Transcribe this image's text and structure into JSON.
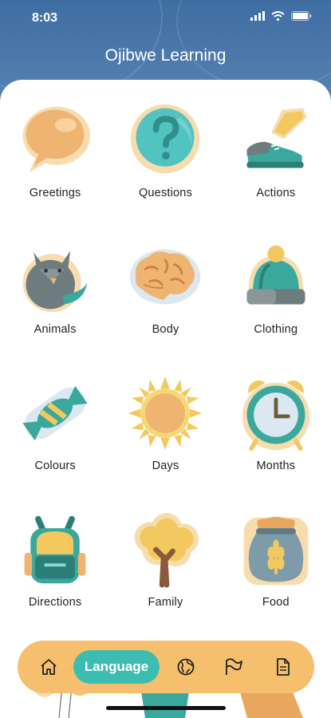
{
  "status_bar": {
    "time": "8:03"
  },
  "app": {
    "title": "Ojibwe Learning"
  },
  "categories": [
    {
      "label": "Greetings",
      "icon": "speech-bubble-icon"
    },
    {
      "label": "Questions",
      "icon": "question-mark-icon"
    },
    {
      "label": "Actions",
      "icon": "running-shoe-icon"
    },
    {
      "label": "Animals",
      "icon": "fox-icon"
    },
    {
      "label": "Body",
      "icon": "brain-icon"
    },
    {
      "label": "Clothing",
      "icon": "winter-hat-icon"
    },
    {
      "label": "Colours",
      "icon": "candy-icon"
    },
    {
      "label": "Days",
      "icon": "sun-icon"
    },
    {
      "label": "Months",
      "icon": "alarm-clock-icon"
    },
    {
      "label": "Directions",
      "icon": "backpack-icon"
    },
    {
      "label": "Family",
      "icon": "tree-icon"
    },
    {
      "label": "Food",
      "icon": "grain-sack-icon"
    }
  ],
  "nav": {
    "active_label": "Language",
    "items": [
      "home-icon",
      "language-tab",
      "globe-icon",
      "flag-icon",
      "document-icon"
    ]
  },
  "colors": {
    "header": "#4a76a8",
    "nav_bar": "#f6bf6e",
    "active_pill": "#3dbdb1",
    "teal": "#3aa89d",
    "peach": "#f0b472",
    "gray": "#6f7c7d"
  }
}
